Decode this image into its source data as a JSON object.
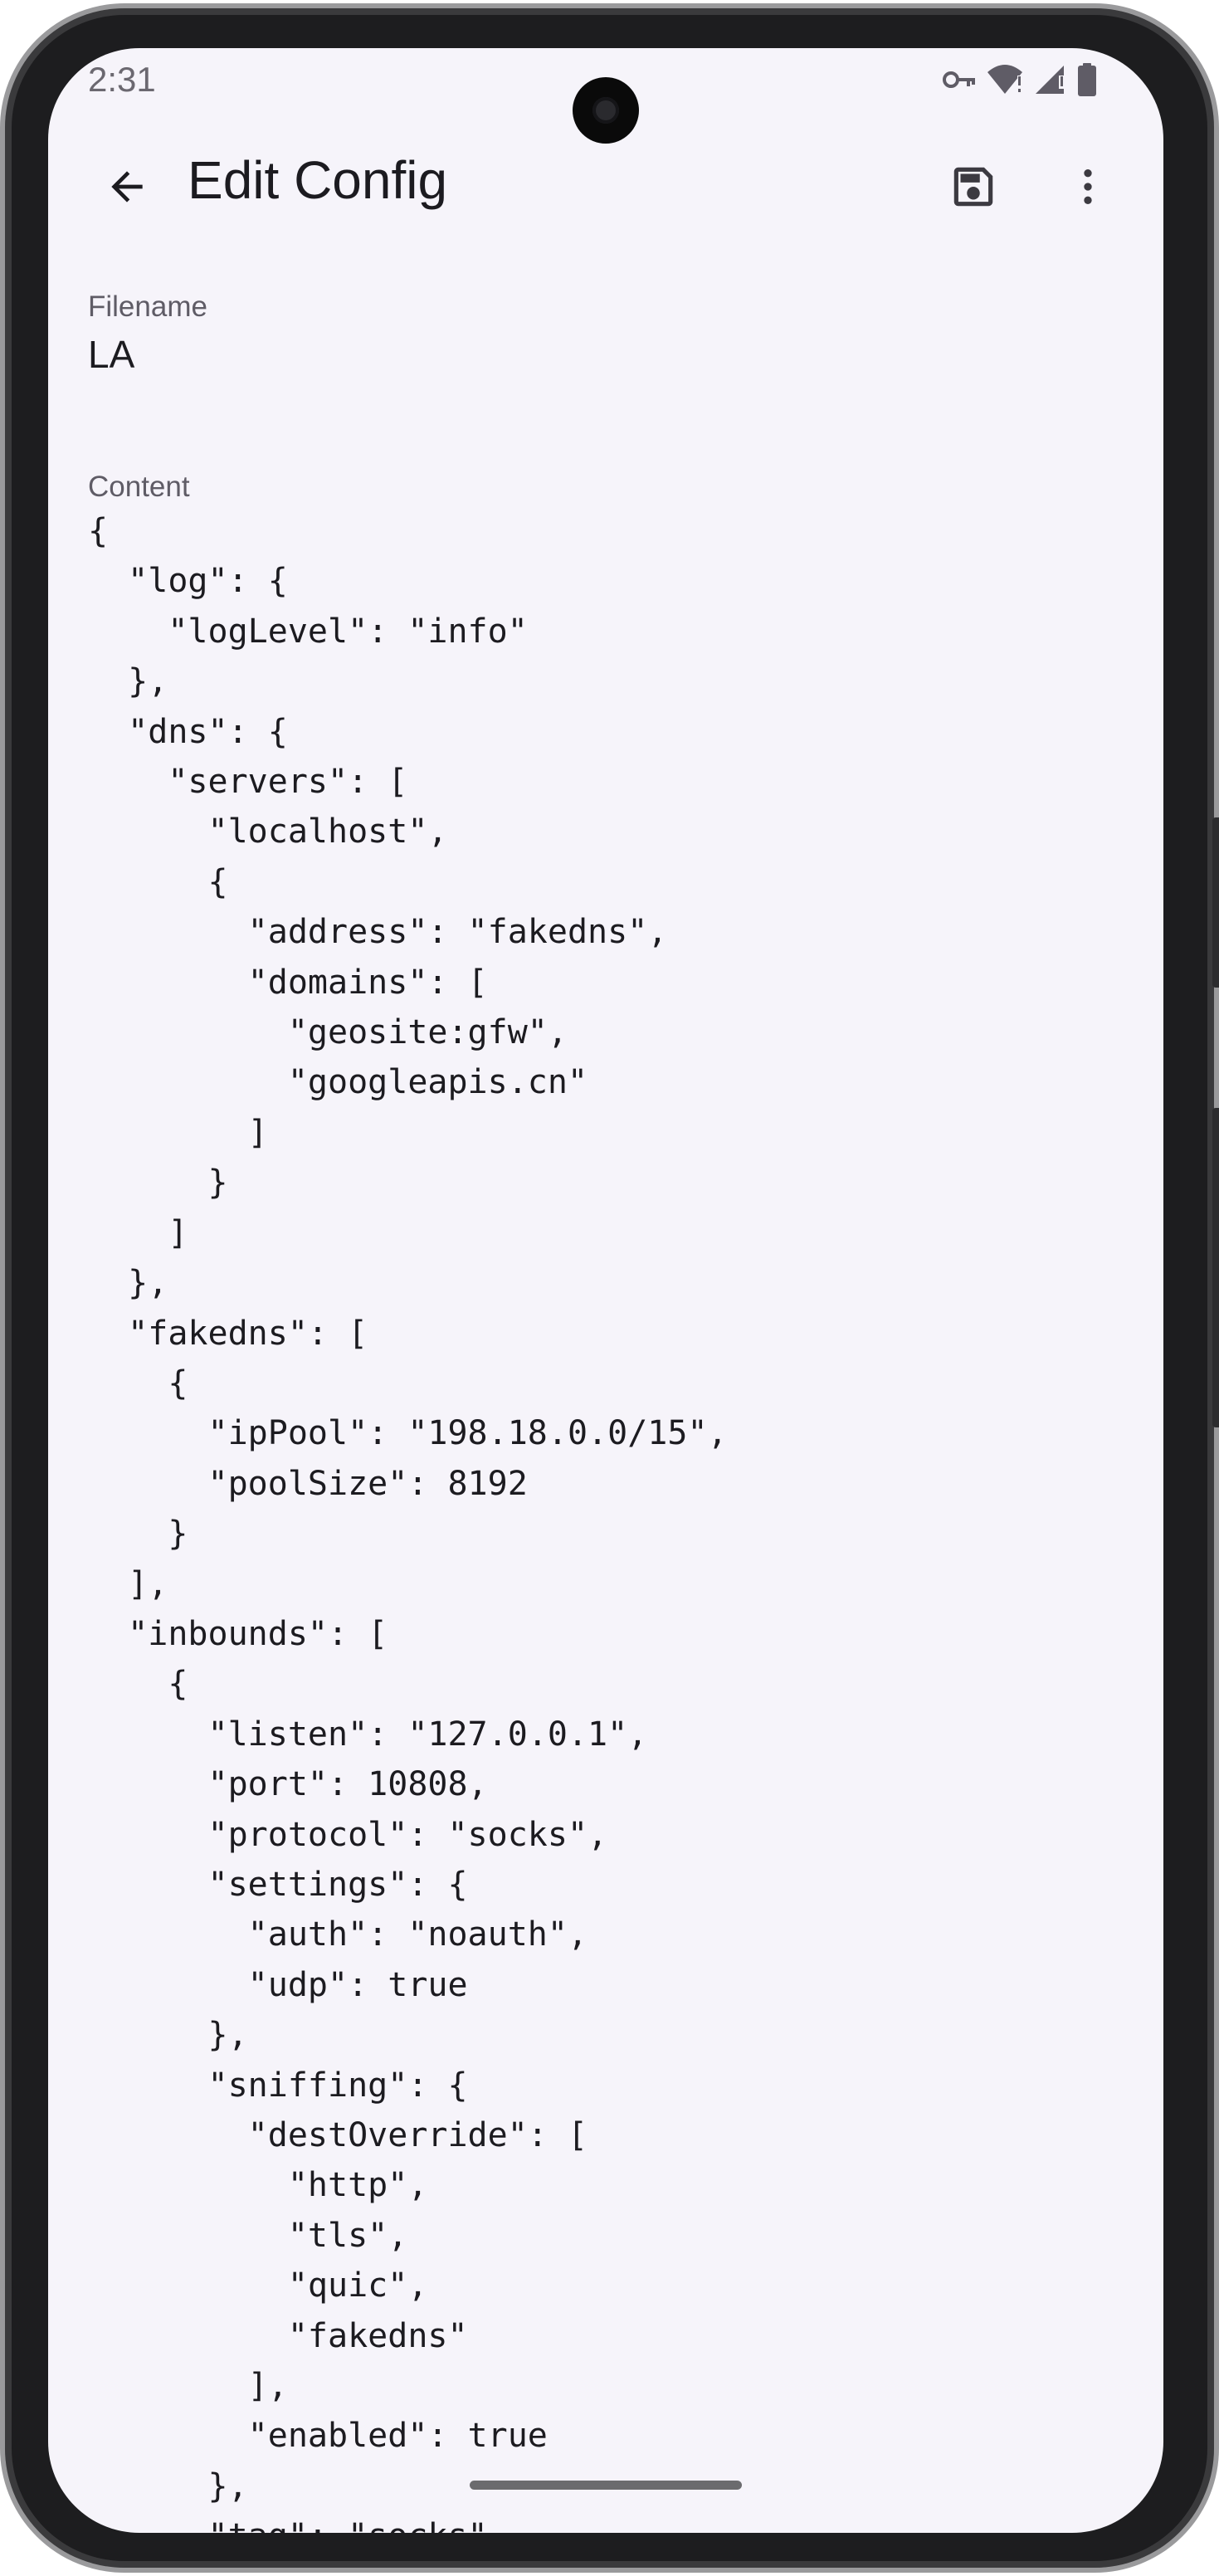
{
  "status_bar": {
    "time": "2:31",
    "icons": [
      "vpn-key-icon",
      "wifi-icon",
      "signal-icon",
      "battery-icon"
    ]
  },
  "app_bar": {
    "title": "Edit Config",
    "back_icon": "arrow-back-icon",
    "save_icon": "save-icon",
    "more_icon": "more-vert-icon"
  },
  "form": {
    "filename_label": "Filename",
    "filename_value": "LA",
    "content_label": "Content",
    "content_lines": [
      "{",
      "  \"log\": {",
      "    \"logLevel\": \"info\"",
      "  },",
      "  \"dns\": {",
      "    \"servers\": [",
      "      \"localhost\",",
      "      {",
      "        \"address\": \"fakedns\",",
      "        \"domains\": [",
      "          \"geosite:gfw\",",
      "          \"googleapis.cn\"",
      "        ]",
      "      }",
      "    ]",
      "  },",
      "  \"fakedns\": [",
      "    {",
      "      \"ipPool\": \"198.18.0.0/15\",",
      "      \"poolSize\": 8192",
      "    }",
      "  ],",
      "  \"inbounds\": [",
      "    {",
      "      \"listen\": \"127.0.0.1\",",
      "      \"port\": 10808,",
      "      \"protocol\": \"socks\",",
      "      \"settings\": {",
      "        \"auth\": \"noauth\",",
      "        \"udp\": true",
      "      },",
      "      \"sniffing\": {",
      "        \"destOverride\": [",
      "          \"http\",",
      "          \"tls\",",
      "          \"quic\",",
      "          \"fakedns\"",
      "        ],",
      "        \"enabled\": true",
      "      },",
      "      \"tag\": \"socks\""
    ]
  },
  "colors": {
    "background": "#f6f4fa",
    "text": "#1c1b20",
    "label": "#5f5c66"
  }
}
